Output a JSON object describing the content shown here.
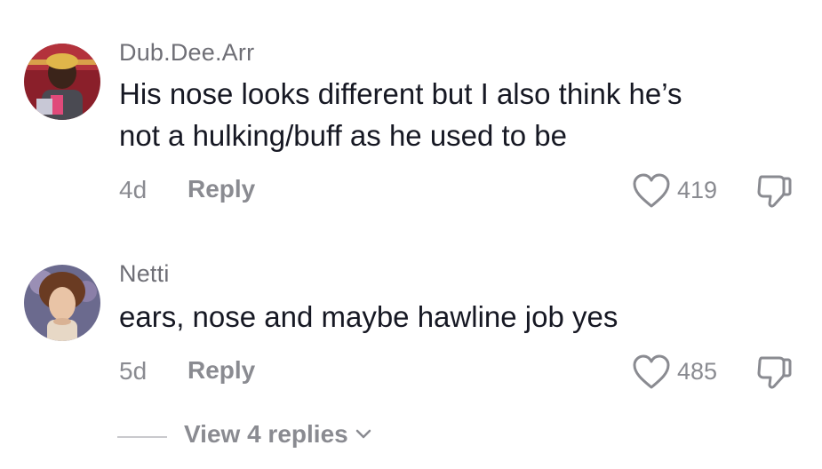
{
  "comments": [
    {
      "username": "Dub.Dee.Arr",
      "avatar_icon": "user-avatar-photo",
      "text_lines": [
        "His nose looks different but I also think he’s",
        "not a hulking/buff as he used to be"
      ],
      "age": "4d",
      "reply_label": "Reply",
      "likes": "419"
    },
    {
      "username": "Netti",
      "avatar_icon": "user-avatar-portrait",
      "text_lines": [
        "ears, nose and maybe hawline job yes"
      ],
      "age": "5d",
      "reply_label": "Reply",
      "likes": "485"
    }
  ],
  "view_replies": {
    "label": "View 4 replies",
    "icon": "chevron-down-icon"
  },
  "colors": {
    "primary_text": "#161823",
    "secondary_text": "#8a8b91",
    "username_text": "#6f6f76"
  }
}
